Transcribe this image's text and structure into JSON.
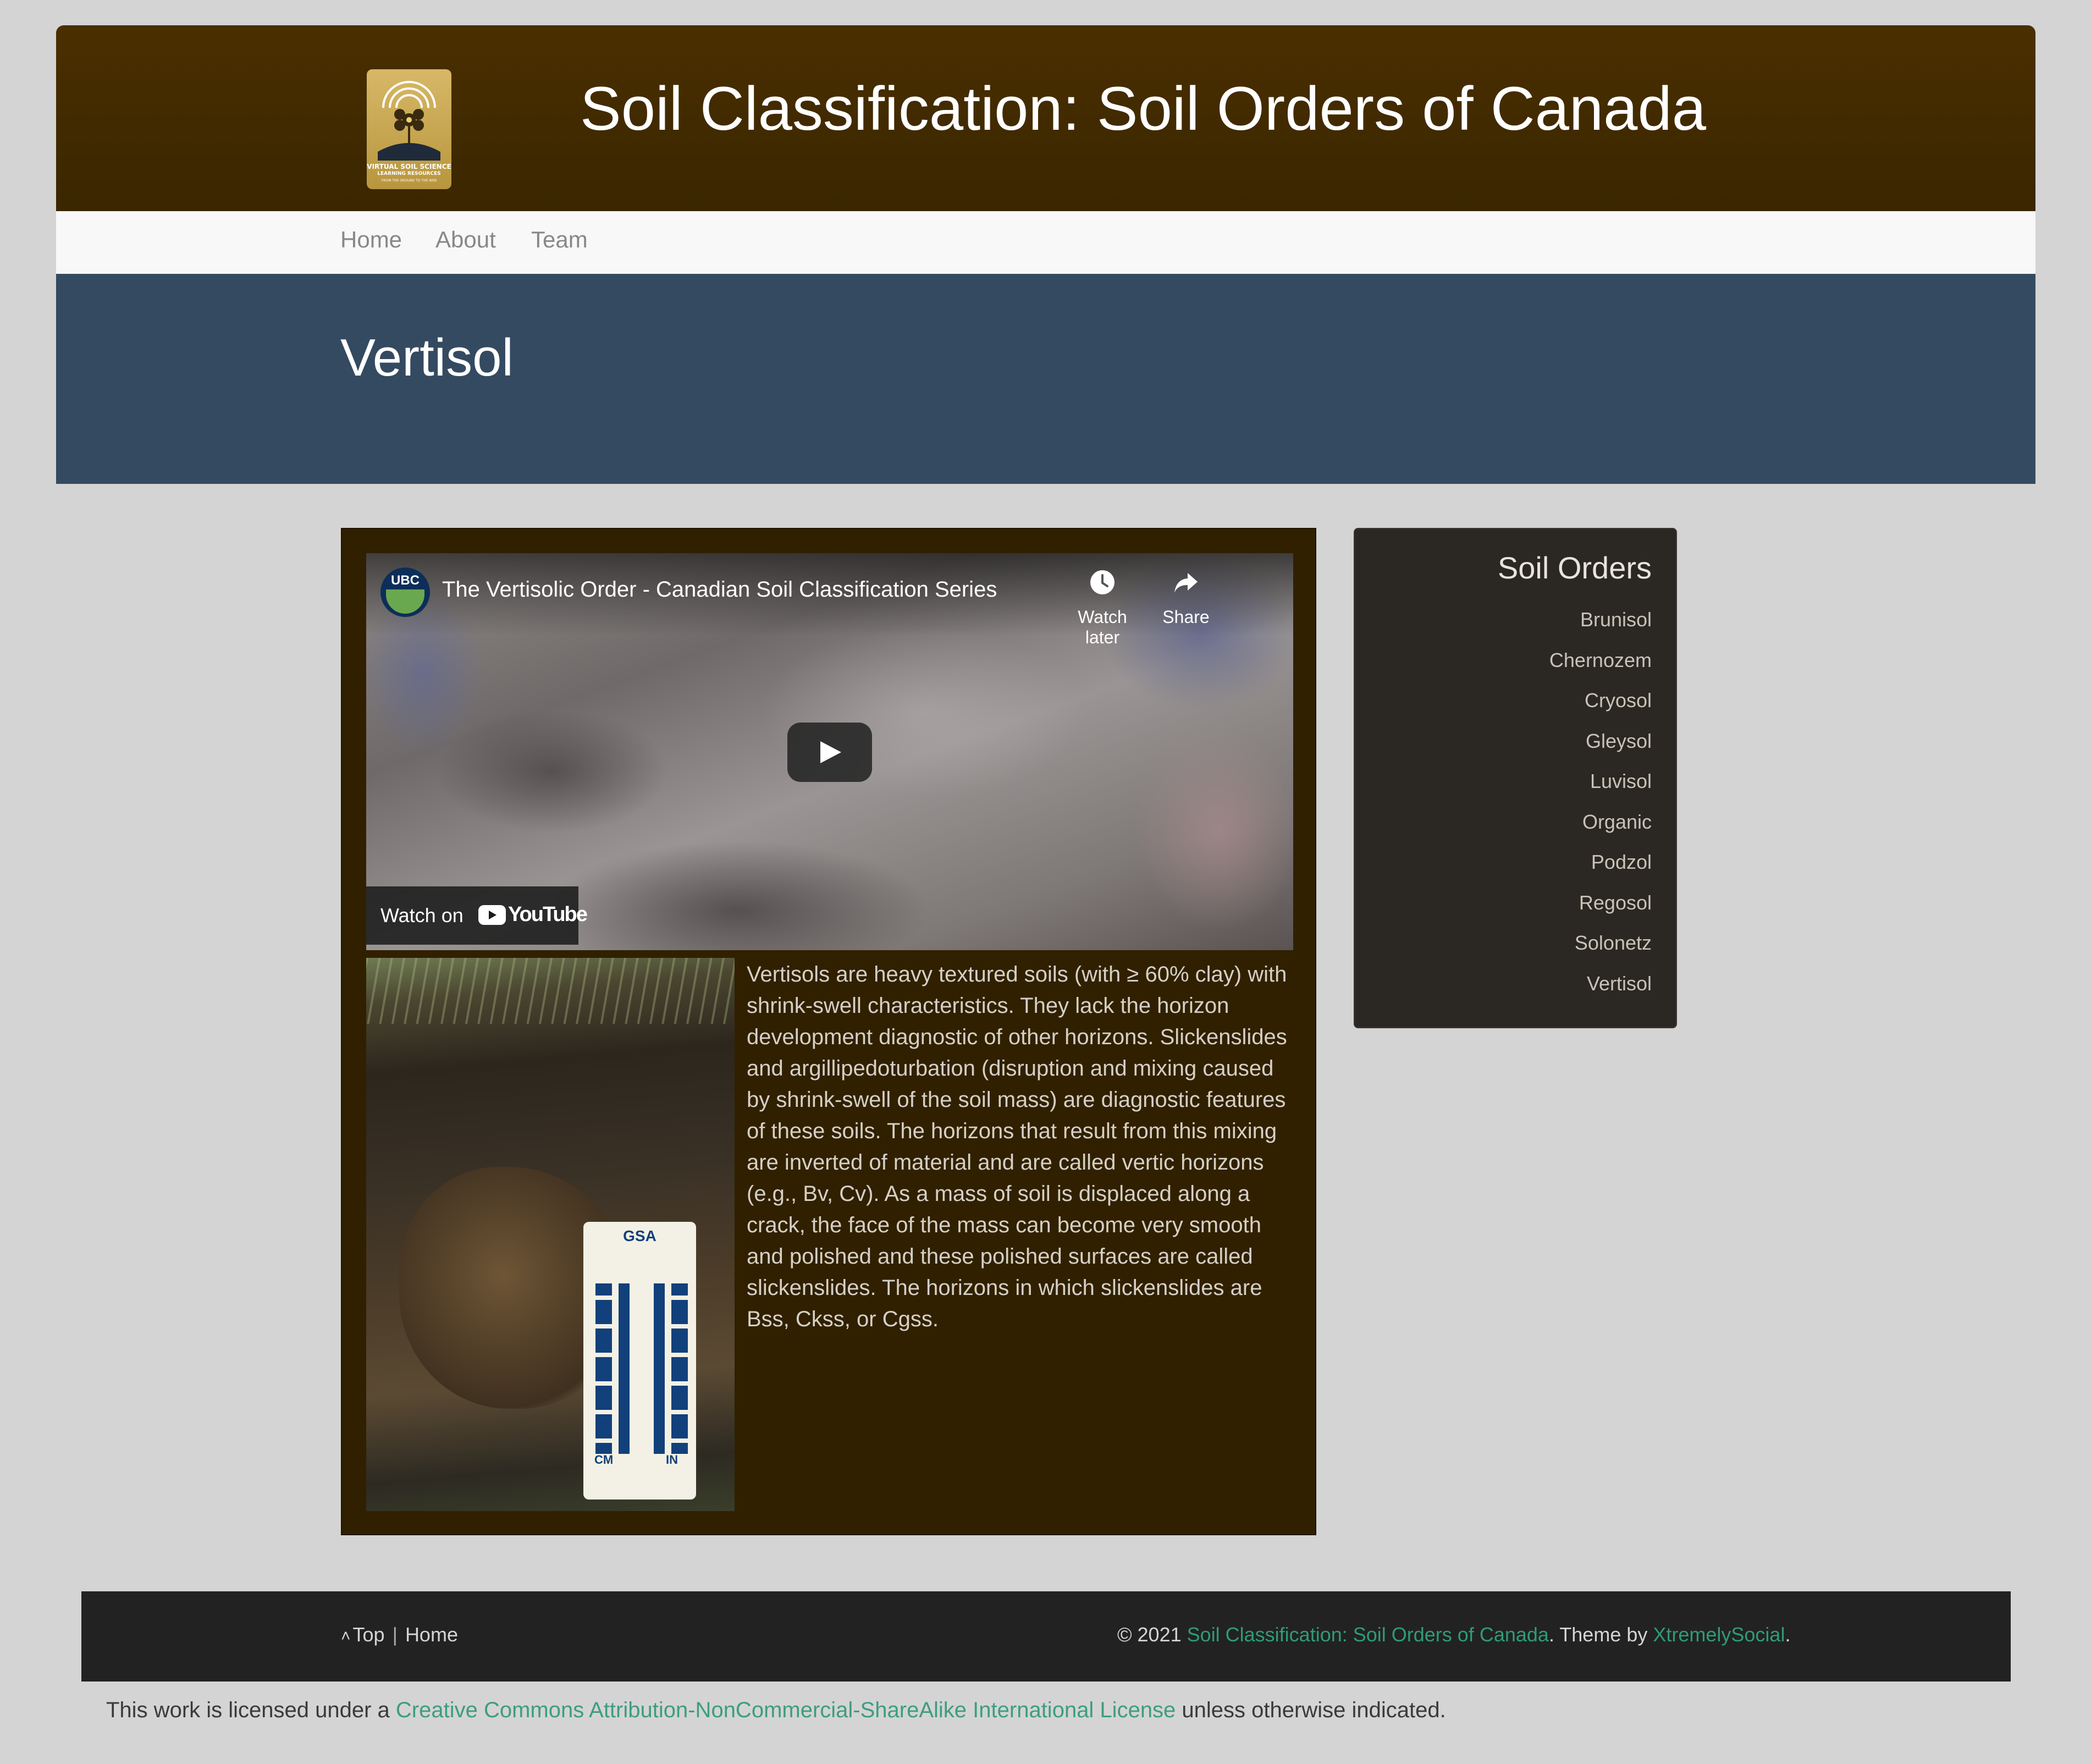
{
  "colors": {
    "header_bg": "#3f2a00",
    "nav_bg": "#f8f8f8",
    "title_band_bg": "#344a60",
    "content_bg": "#302000",
    "sidebar_bg": "#2b2823",
    "footer_bg": "#222222",
    "page_bg": "#d4d4d4",
    "link": "#2e9c77"
  },
  "header": {
    "site_title": "Soil Classification: Soil Orders of Canada",
    "logo": {
      "icon": "virtual-soil-science-logo",
      "line1": "VIRTUAL SOIL SCIENCE",
      "line2": "LEARNING RESOURCES",
      "line3": "FROM THE GROUND TO THE WEB"
    }
  },
  "nav": {
    "items": [
      {
        "label": "Home"
      },
      {
        "label": "About"
      },
      {
        "label": "Team"
      }
    ]
  },
  "page": {
    "title": "Vertisol"
  },
  "video": {
    "channel": "UBC",
    "title": "The Vertisolic Order - Canadian Soil Classification Series",
    "watch_later": "Watch later",
    "share": "Share",
    "watch_on": "Watch on",
    "youtube": "YouTube",
    "icons": {
      "watch_later": "clock-icon",
      "share": "share-arrow-icon",
      "play": "play-icon"
    }
  },
  "photo": {
    "card_label": "GSA",
    "cm": "CM",
    "in": "IN"
  },
  "description": "Vertisols are heavy textured soils (with ≥ 60% clay) with shrink-swell characteristics. They lack the horizon development diagnostic of other horizons. Slickenslides and argillipedoturbation (disruption and mixing caused by shrink-swell of the soil mass) are diagnostic features of these soils. The horizons that result from this mixing are inverted of material and are called vertic horizons (e.g., Bv, Cv). As a mass of soil is displaced along a crack, the face of the mass can become very smooth and polished and these polished surfaces are called slickenslides. The horizons in which slickenslides are Bss, Ckss, or Cgss.",
  "sidebar": {
    "title": "Soil Orders",
    "items": [
      {
        "label": "Brunisol"
      },
      {
        "label": "Chernozem"
      },
      {
        "label": "Cryosol"
      },
      {
        "label": "Gleysol"
      },
      {
        "label": "Luvisol"
      },
      {
        "label": "Organic"
      },
      {
        "label": "Podzol"
      },
      {
        "label": "Regosol"
      },
      {
        "label": "Solonetz"
      },
      {
        "label": "Vertisol"
      }
    ]
  },
  "footer": {
    "top": "Top",
    "home": "Home",
    "copyright_prefix": "© 2021 ",
    "site_link": "Soil Classification: Soil Orders of Canada",
    "theme_text": ". Theme by ",
    "theme_link": "XtremelySocial",
    "suffix": "."
  },
  "license": {
    "prefix": "This work is licensed under a ",
    "link": "Creative Commons Attribution-NonCommercial-ShareAlike International License",
    "suffix": " unless otherwise indicated."
  }
}
